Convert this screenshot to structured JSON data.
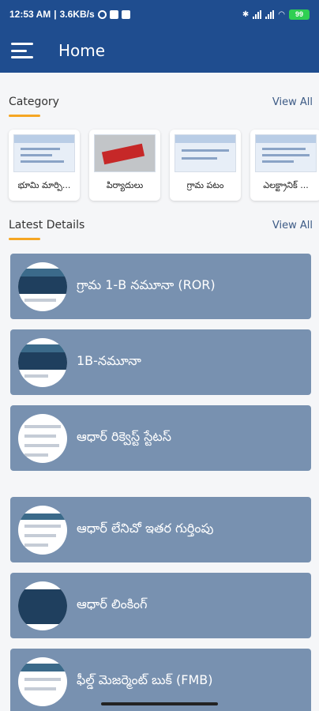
{
  "status": {
    "time": "12:53 AM",
    "speed": "3.6KB/s",
    "battery": "99"
  },
  "appbar": {
    "title": "Home",
    "menu_icon": "hamburger-menu-icon"
  },
  "category": {
    "title": "Category",
    "view_all": "View All",
    "items": [
      {
        "label": "భూమి మార్పి..."
      },
      {
        "label": "పిర్యాదులు"
      },
      {
        "label": "గ్రామ పటం"
      },
      {
        "label": "ఎలక్ట్రానిక్ ..."
      }
    ]
  },
  "latest": {
    "title": "Latest Details",
    "view_all": "View All",
    "items": [
      {
        "label": "గ్రామ 1-B నమూనా (ROR)"
      },
      {
        "label": "1B-నమూనా"
      },
      {
        "label": "ఆధార్ రిక్వెస్ట్ స్టేటస్"
      },
      {
        "label": "ఆధార్ లేనిచో ఇతర గుర్తింపు"
      },
      {
        "label": "ఆధార్ లింకింగ్"
      },
      {
        "label": "ఫీల్డ్ మెజర్మెంట్ బుక్ (FMB)"
      }
    ]
  },
  "colors": {
    "appbar": "#1f4d8f",
    "accent": "#f5a623",
    "card": "#7891b0"
  }
}
